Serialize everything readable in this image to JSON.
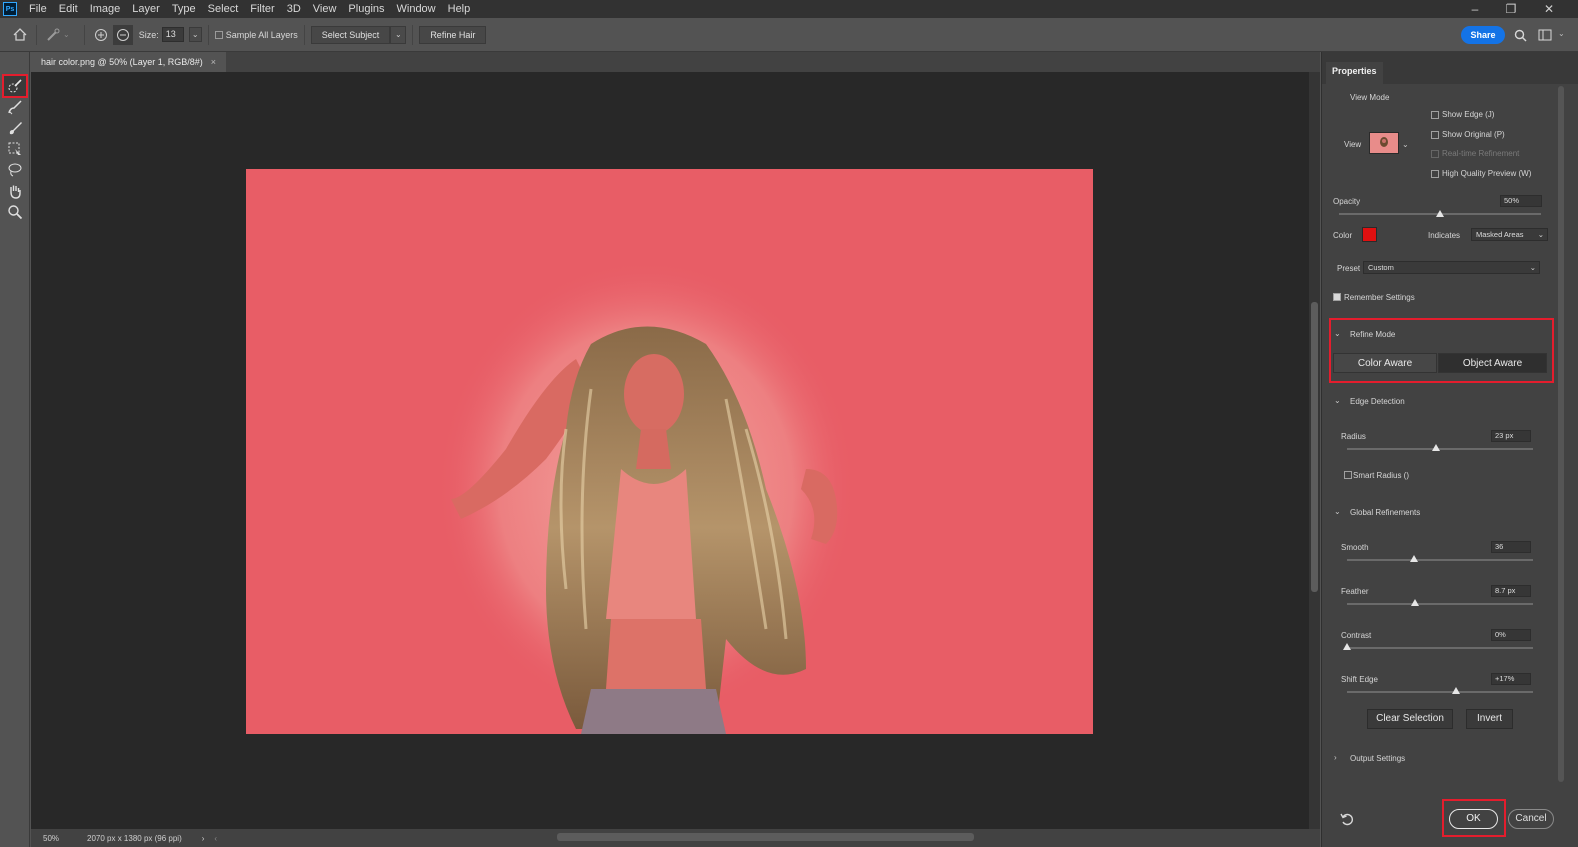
{
  "menubar": {
    "logo": "Ps",
    "items": [
      "File",
      "Edit",
      "Image",
      "Layer",
      "Type",
      "Select",
      "Filter",
      "3D",
      "View",
      "Plugins",
      "Window",
      "Help"
    ]
  },
  "options": {
    "size_label": "Size:",
    "size_value": "13",
    "sample_all_layers": "Sample All Layers",
    "select_subject": "Select Subject",
    "refine_hair": "Refine Hair",
    "share": "Share"
  },
  "document": {
    "tab_title": "hair color.png @ 50% (Layer 1, RGB/8#)",
    "close": "×"
  },
  "status": {
    "zoom": "50%",
    "dimensions": "2070 px x 1380 px (96 ppi)"
  },
  "properties": {
    "title": "Properties",
    "view_mode": {
      "header": "View Mode",
      "view_label": "View",
      "show_edge": "Show Edge (J)",
      "show_original": "Show Original (P)",
      "realtime": "Real-time Refinement",
      "high_quality": "High Quality Preview (W)"
    },
    "opacity_label": "Opacity",
    "opacity_value": "50%",
    "opacity_level": 0.5,
    "color_label": "Color",
    "overlay_color": "#e01010",
    "indicates_label": "Indicates",
    "indicates_value": "Masked Areas",
    "preset_label": "Preset",
    "preset_value": "Custom",
    "remember_settings": "Remember Settings",
    "refine_mode": {
      "header": "Refine Mode",
      "color_aware": "Color Aware",
      "object_aware": "Object Aware",
      "selected": "Object Aware"
    },
    "edge_detection": {
      "header": "Edge Detection",
      "radius_label": "Radius",
      "radius_value": "23 px",
      "smart_radius": "Smart Radius ()"
    },
    "global_refinements": {
      "header": "Global Refinements",
      "smooth_label": "Smooth",
      "smooth_value": "36",
      "feather_label": "Feather",
      "feather_value": "8.7 px",
      "contrast_label": "Contrast",
      "contrast_value": "0%",
      "shift_label": "Shift Edge",
      "shift_value": "+17%"
    },
    "clear_selection": "Clear Selection",
    "invert": "Invert",
    "output_settings": "Output Settings",
    "ok": "OK",
    "cancel": "Cancel"
  },
  "colors": {
    "accent_blue": "#1473e6",
    "highlight_red": "#e41d2d",
    "mask_overlay": "#e85d66"
  }
}
